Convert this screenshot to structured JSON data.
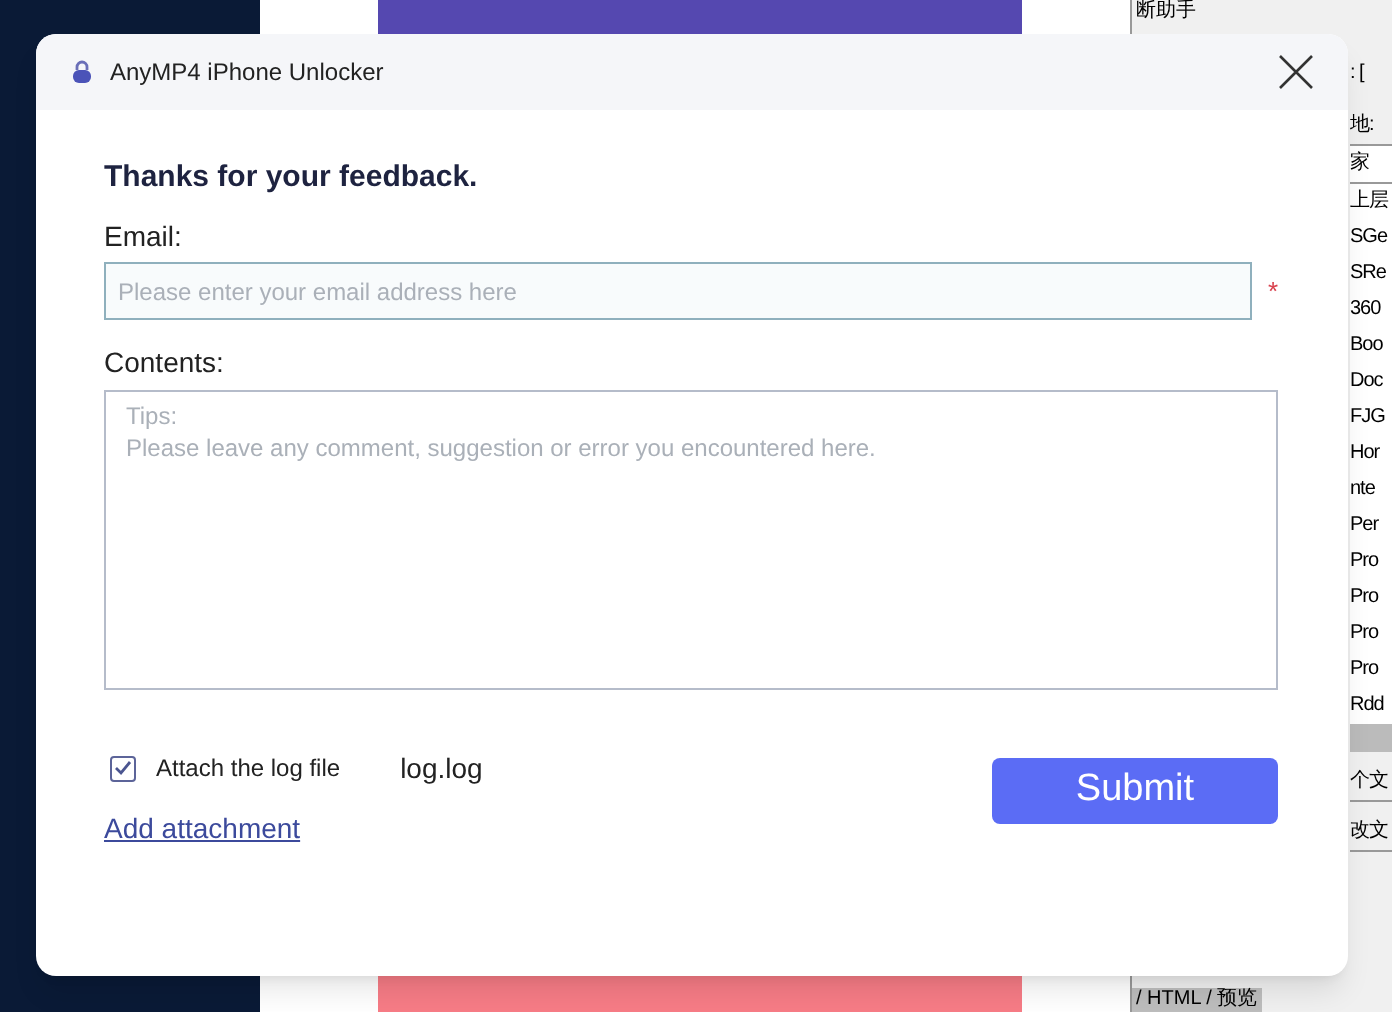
{
  "window": {
    "title": "AnyMP4 iPhone Unlocker"
  },
  "heading": "Thanks for your feedback.",
  "email": {
    "label": "Email:",
    "placeholder": "Please enter your email address here",
    "required_mark": "*"
  },
  "contents": {
    "label": "Contents:",
    "placeholder": "Tips:\nPlease leave any comment, suggestion or error you encountered here."
  },
  "attach_log": {
    "label": "Attach the log file",
    "checked": true,
    "file": "log.log"
  },
  "add_attachment": "Add attachment",
  "submit": "Submit",
  "background_window": {
    "top_tab": "断助手",
    "fields": [
      ": [",
      "地:"
    ],
    "column_header": "家",
    "items": [
      "上层",
      "SGe",
      "SRe",
      "360",
      "Boo",
      "Doc",
      "FJG",
      "Hor",
      "nte",
      "Per",
      "Pro",
      "Pro",
      "Pro",
      "Pro",
      "Rdd"
    ],
    "bottom_rows": [
      "个文",
      "改文"
    ],
    "bottom_tabs": "/ HTML / 预览"
  }
}
